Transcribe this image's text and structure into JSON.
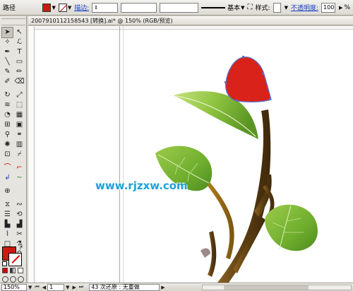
{
  "control_bar": {
    "tool_name": "路径",
    "fill_color": "#cc1a12",
    "stroke_label": "描边:",
    "stroke_weight": "",
    "brush_field": "",
    "profile_label": "基本",
    "style_label": "样式:",
    "opacity_label": "不透明度:",
    "opacity_value": "100",
    "percent": "%"
  },
  "document": {
    "tab_title": "2007910112158543 [转换].ai* @ 150% (RGB/预览)",
    "zoom": "150%"
  },
  "watermark": "www.rjzxw.com",
  "status_bar": {
    "zoom_value": "150%",
    "page_value": "1",
    "status_text": "43 次还原 : 无重做"
  },
  "tools": [
    "selection-tool",
    "direct-selection-tool",
    "magic-wand-tool",
    "lasso-tool",
    "pen-tool",
    "type-tool",
    "line-tool",
    "rectangle-tool",
    "paintbrush-tool",
    "pencil-tool",
    "blob-brush-tool",
    "eraser-tool",
    "rotate-tool",
    "scale-tool",
    "warp-tool",
    "free-transform-tool",
    "symbol-sprayer-tool",
    "graph-tool",
    "mesh-tool",
    "gradient-tool",
    "eyedropper-tool",
    "blend-tool",
    "live-paint-bucket-tool",
    "live-paint-selection-tool",
    "artboard-tool",
    "slice-tool",
    "hand-tool",
    "zoom-tool"
  ],
  "colors": {
    "fill": "#cc1a12",
    "stroke": "#ffffff",
    "leaf": "#7cb83a",
    "stem": "#6b4a1a",
    "link": "#1a44c8",
    "watermark": "#1da1d8"
  }
}
